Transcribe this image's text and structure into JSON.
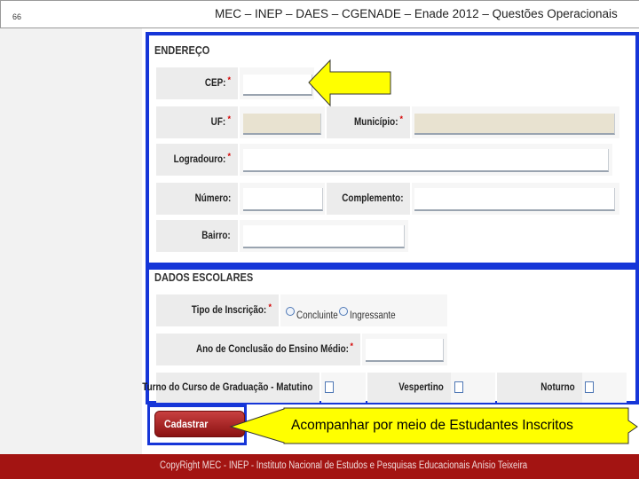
{
  "slide": {
    "page_number": "66",
    "title": "MEC – INEP – DAES – CGENADE – Enade 2012 – Questões Operacionais"
  },
  "endereco": {
    "section_title": "ENDEREÇO",
    "required_marker": "*",
    "cep_label": "CEP:",
    "uf_label": "UF:",
    "municipio_label": "Município:",
    "logradouro_label": "Logradouro:",
    "numero_label": "Número:",
    "complemento_label": "Complemento:",
    "bairro_label": "Bairro:"
  },
  "dados_escolares": {
    "section_title": "DADOS ESCOLARES",
    "tipo_label": "Tipo de Inscrição:",
    "option_concluinte": "Concluinte",
    "option_ingressante": "Ingressante",
    "ano_label": "Ano de Conclusão do Ensino Médio:",
    "turno_label": "Turno do Curso de Graduação - Matutino",
    "vespertino_label": "Vespertino",
    "noturno_label": "Noturno"
  },
  "actions": {
    "submit_label": "Cadastrar"
  },
  "callout": {
    "text": "Acompanhar por meio de Estudantes Inscritos"
  },
  "footer": {
    "text": "CopyRight MEC - INEP - Instituto Nacional de Estudos e Pesquisas Educacionais Anísio Teixeira"
  },
  "colors": {
    "frame_blue": "#1636d8",
    "arrow_yellow": "#ffff00",
    "footer_red": "#a31412",
    "button_red": "#b02020"
  }
}
